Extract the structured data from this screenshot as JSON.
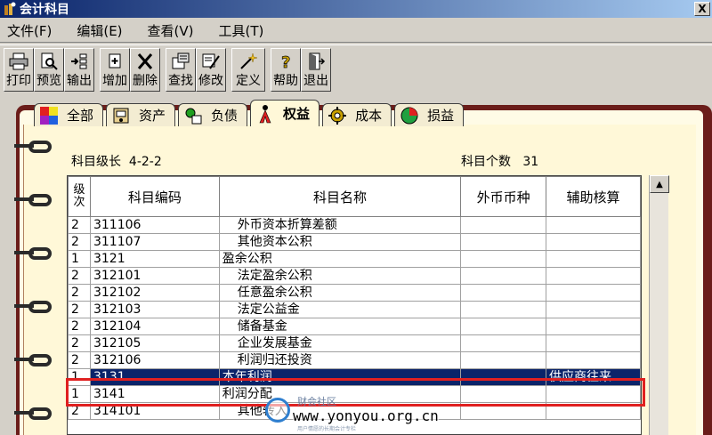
{
  "window": {
    "title": "会计科目",
    "close_label": "X"
  },
  "menu": [
    {
      "label": "文件(F)"
    },
    {
      "label": "编辑(E)"
    },
    {
      "label": "查看(V)"
    },
    {
      "label": "工具(T)"
    }
  ],
  "toolbar": {
    "print": "打印",
    "preview": "预览",
    "export": "输出",
    "add": "增加",
    "delete": "删除",
    "find": "查找",
    "modify": "修改",
    "define": "定义",
    "help": "帮助",
    "exit": "退出"
  },
  "tabs": [
    {
      "label": "全部",
      "icon": "all-icon"
    },
    {
      "label": "资产",
      "icon": "assets-icon"
    },
    {
      "label": "负债",
      "icon": "liabilities-icon"
    },
    {
      "label": "权益",
      "icon": "equity-icon",
      "active": true
    },
    {
      "label": "成本",
      "icon": "cost-icon"
    },
    {
      "label": "损益",
      "icon": "profit-loss-icon"
    }
  ],
  "info": {
    "level_label": "科目级长",
    "level_value": "4-2-2",
    "count_label": "科目个数",
    "count_value": "31"
  },
  "table": {
    "headers": {
      "level": "级次",
      "code": "科目编码",
      "name": "科目名称",
      "currency": "外币币种",
      "aux": "辅助核算"
    },
    "rows": [
      {
        "level": "2",
        "code": "311106",
        "name": "外币资本折算差额",
        "currency": "",
        "aux": ""
      },
      {
        "level": "2",
        "code": "311107",
        "name": "其他资本公积",
        "currency": "",
        "aux": ""
      },
      {
        "level": "1",
        "code": "3121",
        "name": "盈余公积",
        "currency": "",
        "aux": ""
      },
      {
        "level": "2",
        "code": "312101",
        "name": "法定盈余公积",
        "currency": "",
        "aux": ""
      },
      {
        "level": "2",
        "code": "312102",
        "name": "任意盈余公积",
        "currency": "",
        "aux": ""
      },
      {
        "level": "2",
        "code": "312103",
        "name": "法定公益金",
        "currency": "",
        "aux": ""
      },
      {
        "level": "2",
        "code": "312104",
        "name": "储备基金",
        "currency": "",
        "aux": ""
      },
      {
        "level": "2",
        "code": "312105",
        "name": "企业发展基金",
        "currency": "",
        "aux": ""
      },
      {
        "level": "2",
        "code": "312106",
        "name": "利润归还投资",
        "currency": "",
        "aux": ""
      },
      {
        "level": "1",
        "code": "3131",
        "name": "本年利润",
        "currency": "",
        "aux": "供应商往来",
        "selected": true
      },
      {
        "level": "1",
        "code": "3141",
        "name": "利润分配",
        "currency": "",
        "aux": ""
      },
      {
        "level": "2",
        "code": "314101",
        "name": "其他转入",
        "currency": "",
        "aux": ""
      }
    ]
  },
  "watermark": {
    "cn": "财会社区",
    "url": "www.yonyou.org.cn",
    "sub": "用户情愿的长期会计专栏"
  },
  "colors": {
    "selection": "#0a246a",
    "highlight_border": "#e02020",
    "binder": "#6b1d1a"
  }
}
